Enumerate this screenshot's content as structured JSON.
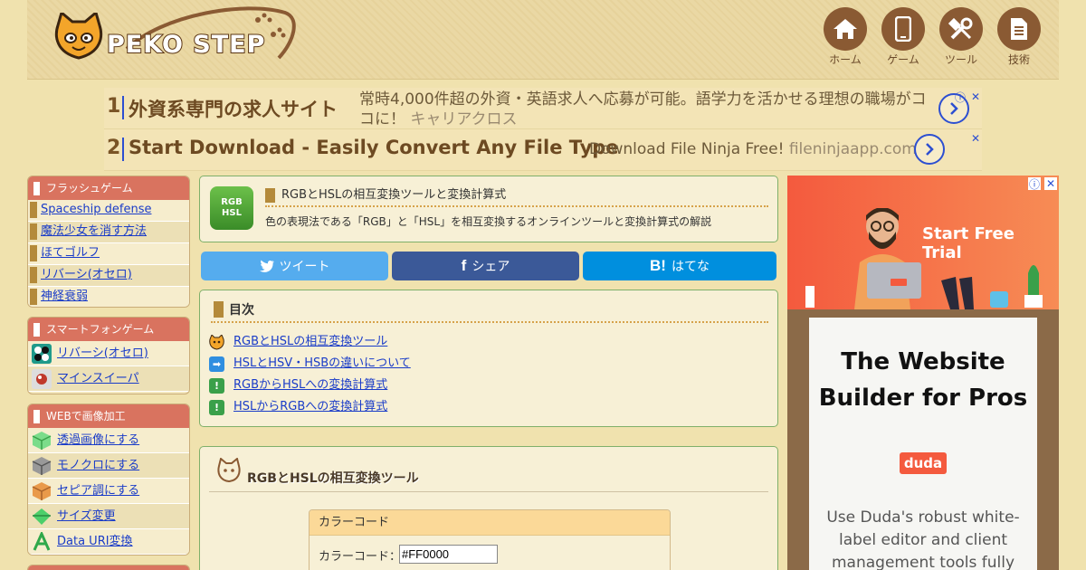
{
  "header": {
    "logo_text": "PEKO STEP",
    "nav": [
      {
        "label": "ホーム",
        "icon": "home-icon"
      },
      {
        "label": "ゲーム",
        "icon": "smartphone-icon"
      },
      {
        "label": "ツール",
        "icon": "tools-icon"
      },
      {
        "label": "技術",
        "icon": "document-icon"
      }
    ]
  },
  "ads": [
    {
      "num": "1",
      "title": "外資系専門の求人サイト",
      "desc": "常時4,000件超の外資・英語求人へ応募が可能。語学力を活かせる理想の職場がココに！",
      "domain": "キャリアクロス"
    },
    {
      "num": "2",
      "title": "Start Download - Easily Convert Any File Type",
      "desc": "Download File Ninja Free!",
      "domain": "fileninjaapp.com"
    }
  ],
  "sidebar": {
    "flash": {
      "title": "フラッシュゲーム",
      "items": [
        "Spaceship defense",
        "魔法少女を消す方法",
        "ほてゴルフ",
        "リバーシ(オセロ)",
        "神経衰弱"
      ]
    },
    "smartphone": {
      "title": "スマートフォンゲーム",
      "items": [
        "リバーシ(オセロ)",
        "マインスイーパ"
      ]
    },
    "web": {
      "title": "WEBで画像加工",
      "items": [
        "透過画像にする",
        "モノクロにする",
        "セピア調にする",
        "サイズ変更",
        "Data URI変換"
      ]
    }
  },
  "article": {
    "tool_icon_text": "RGB HSL",
    "title": "RGBとHSLの相互変換ツールと変換計算式",
    "subtitle": "色の表現法である「RGB」と「HSL」を相互変換するオンラインツールと変換計算式の解説"
  },
  "share": {
    "tweet": "ツイート",
    "facebook": "シェア",
    "hatena": "はてな",
    "hatena_mark": "B!",
    "facebook_mark": "f"
  },
  "toc": {
    "title": "目次",
    "items": [
      "RGBとHSLの相互変換ツール",
      "HSLとHSV・HSBの違いについて",
      "RGBからHSLへの変換計算式",
      "HSLからRGBへの変換計算式"
    ]
  },
  "section": {
    "title": "RGBとHSLの相互変換ツール",
    "box_title": "カラーコード",
    "field_label": "カラーコード：",
    "field_value": "#FF0000"
  },
  "right_ad": {
    "cta": "Start Free Trial",
    "headline": "The Website Builder for Pros",
    "brand": "duda",
    "body": "Use Duda's robust white-label editor and client management tools fully"
  },
  "colors": {
    "accent": "#8a5a33",
    "twitter": "#55acee",
    "facebook": "#3b5998",
    "hatena": "#008fde",
    "ad_orange": "#f45a3e"
  }
}
